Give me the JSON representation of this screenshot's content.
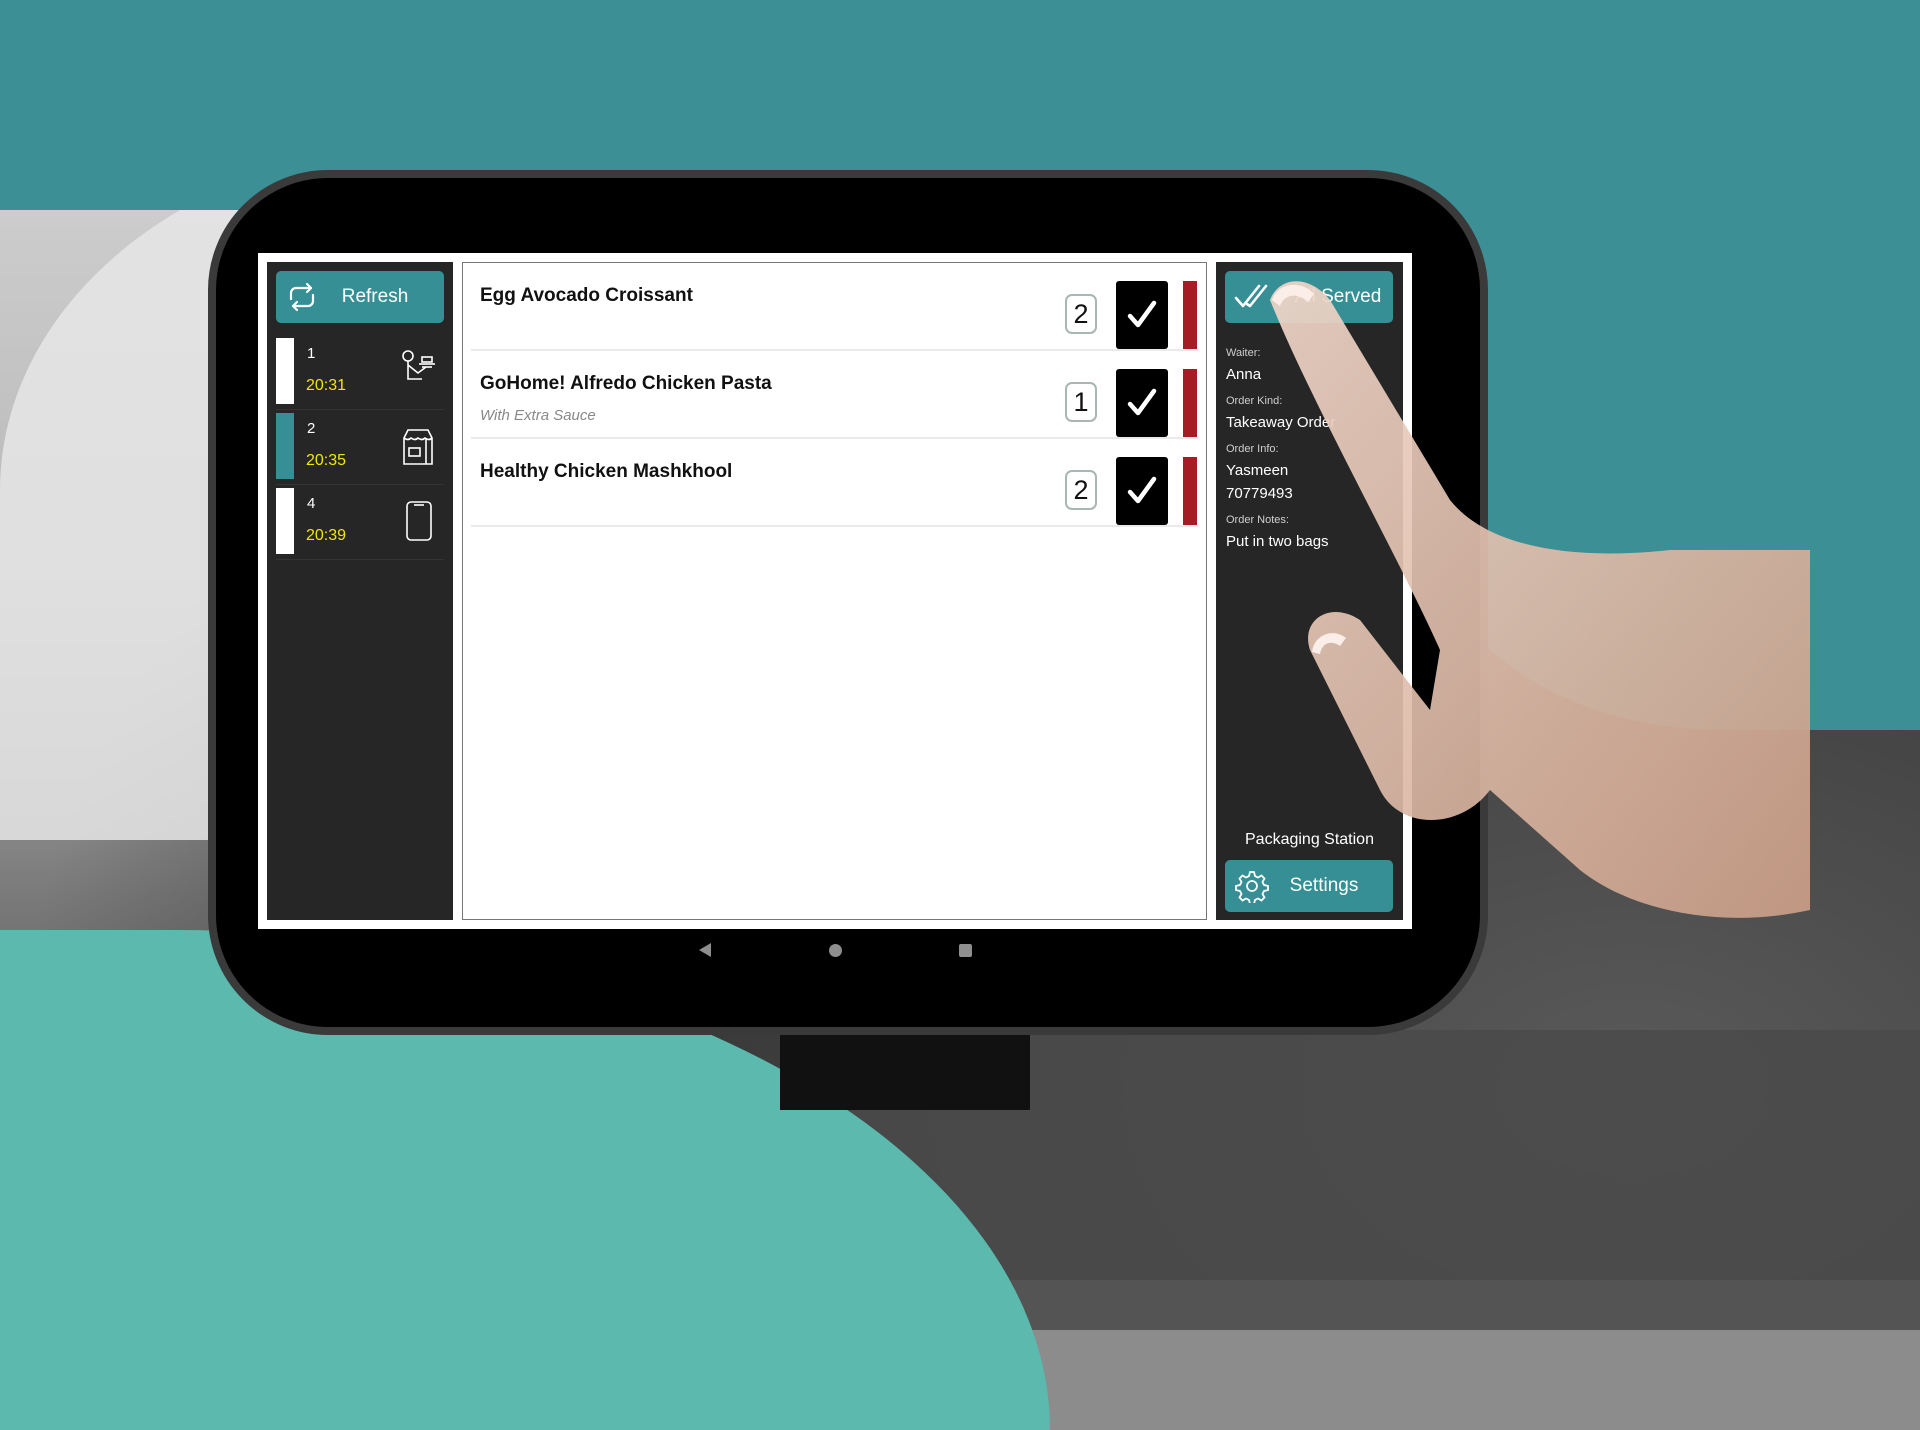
{
  "left_panel": {
    "refresh_label": "Refresh",
    "orders": [
      {
        "number": "1",
        "time": "20:31",
        "kind_icon": "waiter-serving-icon",
        "selected": false
      },
      {
        "number": "2",
        "time": "20:35",
        "kind_icon": "takeaway-bag-icon",
        "selected": true
      },
      {
        "number": "4",
        "time": "20:39",
        "kind_icon": "mobile-phone-icon",
        "selected": false
      }
    ]
  },
  "items": [
    {
      "name": "Egg Avocado Croissant",
      "modifier": "",
      "quantity": "2"
    },
    {
      "name": "GoHome! Alfredo Chicken Pasta",
      "modifier": "With Extra Sauce",
      "quantity": "1"
    },
    {
      "name": "Healthy Chicken Mashkhool",
      "modifier": "",
      "quantity": "2"
    }
  ],
  "right_panel": {
    "all_served_label": "All Served",
    "waiter_label": "Waiter:",
    "waiter_value": "Anna",
    "order_kind_label": "Order Kind:",
    "order_kind_value": "Takeaway Order",
    "order_info_label": "Order Info:",
    "order_info_name": "Yasmeen",
    "order_info_phone": "70779493",
    "order_notes_label": "Order Notes:",
    "order_notes_value": "Put in two bags",
    "station_name": "Packaging Station",
    "settings_label": "Settings"
  },
  "colors": {
    "accent_teal": "#358f95",
    "time_yellow": "#f2e600",
    "status_red": "#a51c24",
    "panel_dark": "#262626"
  }
}
